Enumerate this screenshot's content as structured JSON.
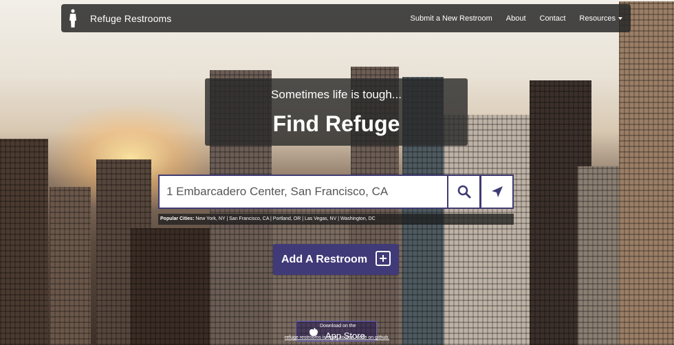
{
  "navbar": {
    "brand": "Refuge Restrooms",
    "links": [
      "Submit a New Restroom",
      "About",
      "Contact",
      "Resources"
    ]
  },
  "hero": {
    "subtitle": "Sometimes life is tough...",
    "title": "Find Refuge"
  },
  "search": {
    "placeholder": "1 Embarcadero Center, San Francisco, CA",
    "search_icon": "search-icon",
    "location_icon": "location-arrow-icon"
  },
  "popular": {
    "label": "Popular Cities:",
    "cities": "New York, NY | San Francisco, CA | Portland, OR | Las Vegas, NV | Washington, DC"
  },
  "add_restroom": {
    "label": "Add A Restroom"
  },
  "footer": {
    "appstore_small": "Download on the",
    "appstore_big": "App Store",
    "text": "refuge restrooms is open source. code on github."
  },
  "colors": {
    "accent": "#403a78"
  }
}
